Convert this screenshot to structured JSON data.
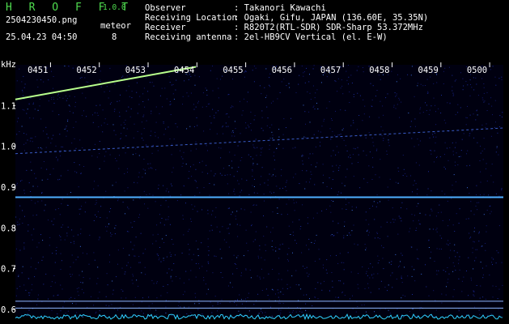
{
  "app": {
    "title": "H R O F F T",
    "version": "1.0.0"
  },
  "file": {
    "name": "2504230450.png",
    "datetime": "25.04.23 04:50"
  },
  "meteor": {
    "label": "meteor",
    "count": "8"
  },
  "info": [
    {
      "key": "Observer",
      "value": ": Takanori Kawachi"
    },
    {
      "key": "Receiving Location",
      "value": ": Ogaki, Gifu, JAPAN (136.60E, 35.35N)"
    },
    {
      "key": "Receiver",
      "value": ": R820T2(RTL-SDR) SDR-Sharp 53.372MHz"
    },
    {
      "key": "Receiving antenna",
      "value": ": 2el-HB9CV Vertical (el. E-W)"
    }
  ],
  "colors": {
    "header_green": "#4fdc4f",
    "signal": "#4fb0ff",
    "trace": "#b8ff8c",
    "background": "#000010"
  },
  "chart_data": {
    "type": "heatmap",
    "ylabel": "kHz",
    "x_ticks": [
      "0451",
      "0452",
      "0453",
      "0454",
      "0455",
      "0456",
      "0457",
      "0458",
      "0459",
      "0500"
    ],
    "y_ticks": [
      "1.1",
      "1.0",
      "0.9",
      "0.8",
      "0.7",
      "0.6"
    ],
    "ylim": [
      0.58,
      1.2
    ],
    "xlim_minutes": [
      0,
      10
    ],
    "features": {
      "carrier_line_khz": 0.875,
      "reference_lines_khz": [
        0.62,
        0.603
      ],
      "weak_drift_khz": [
        0.982,
        1.045
      ],
      "meteor_trace": {
        "start_minute": 0.0,
        "end_minute": 3.7,
        "start_khz": 1.115,
        "end_khz": 1.195
      }
    }
  }
}
